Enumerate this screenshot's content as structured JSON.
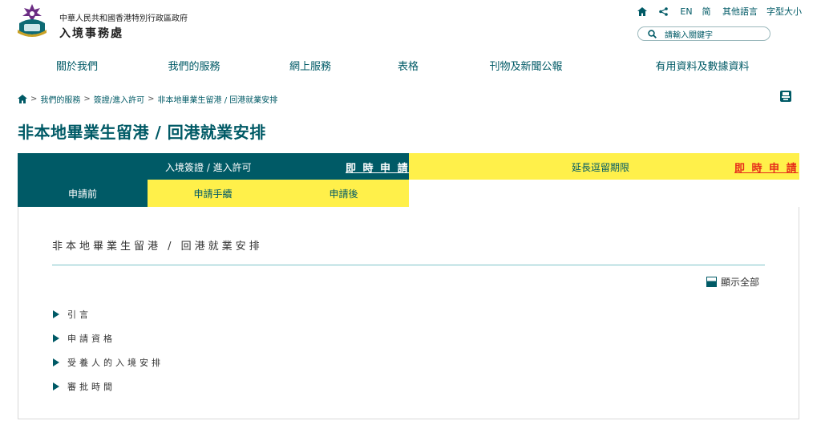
{
  "header": {
    "gov_name": "中華人民共和國香港特別行政區政府",
    "dept_name": "入境事務處",
    "utility": {
      "en_label": "EN",
      "sc_label": "简",
      "other_lang_label": "其他語言",
      "font_size_label": "字型大小"
    },
    "search_placeholder": "請輸入關鍵字"
  },
  "nav": {
    "items": [
      "關於我們",
      "我們的服務",
      "網上服務",
      "表格",
      "刊物及新聞公報",
      "有用資料及數據資料"
    ]
  },
  "breadcrumb": {
    "items": [
      "我們的服務",
      "簽證/進入許可",
      "非本地畢業生留港 / 回港就業安排"
    ]
  },
  "page_title": "非本地畢業生留港 / 回港就業安排",
  "tabs": {
    "visa": {
      "label": "入境簽證 / 進入許可",
      "apply_label": "即 時 申 請"
    },
    "extend": {
      "label": "延長逗留期限",
      "apply_label": "即 時 申 請"
    }
  },
  "subtabs": [
    "申請前",
    "申請手續",
    "申請後"
  ],
  "content": {
    "section_title": "非本地畢業生留港 / 回港就業安排",
    "show_all_label": "顯示全部",
    "accordion": [
      "引言",
      "申請資格",
      "受養人的入境安排",
      "審批時間"
    ]
  },
  "colors": {
    "brand": "#005a66",
    "yellow": "#fff04a",
    "apply_red": "#e62a1a",
    "divider": "#7cc3c9",
    "emblem_purple": "#6b2c83"
  }
}
